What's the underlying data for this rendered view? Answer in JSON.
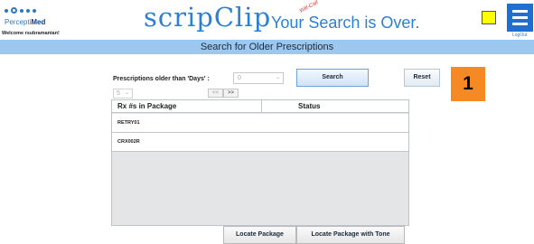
{
  "header": {
    "logo_brand_light": "Percepti",
    "logo_brand_bold": "Med",
    "welcome": "Welcome rsubramanian!",
    "app_name": "scripClip",
    "tagline": "Your Search is Over.",
    "stamp_text": "Will-Call",
    "logout": "LogOut",
    "colors": {
      "brand_blue": "#2c7fd6",
      "menu_blue": "#1f6fd0",
      "indicator": "#ffff00"
    }
  },
  "page_title": "Search for Older Prescriptions",
  "filter": {
    "days_label": "Prescriptions older than 'Days' :",
    "days_value": "0",
    "search_label": "Search",
    "reset_label": "Reset"
  },
  "callout": {
    "number": "1",
    "color": "#f58a24"
  },
  "pager": {
    "page_size": "5",
    "prev": "<<",
    "next": ">>"
  },
  "table": {
    "columns": [
      "Rx #s in Package",
      "Status"
    ],
    "rows": [
      {
        "rx": "RETRY01",
        "status": ""
      },
      {
        "rx": "CRX002R",
        "status": ""
      }
    ]
  },
  "actions": {
    "locate": "Locate Package",
    "locate_tone": "Locate Package with Tone"
  }
}
